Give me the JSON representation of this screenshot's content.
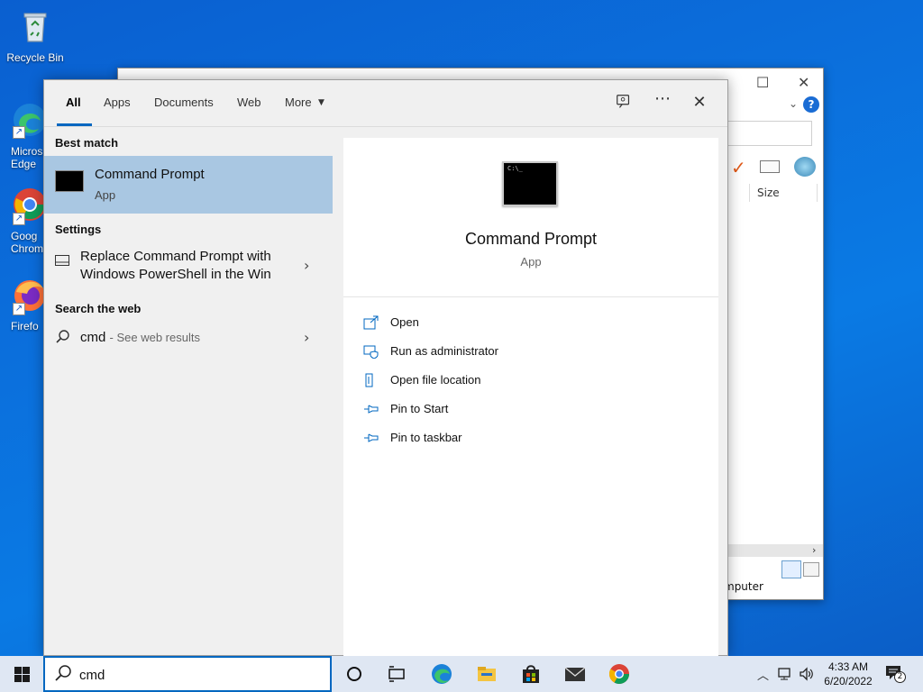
{
  "desktop": {
    "icons": [
      {
        "label": "Recycle Bin"
      },
      {
        "label": "Micros Edge"
      },
      {
        "label": "Goog Chrom"
      },
      {
        "label": "Firefo"
      }
    ]
  },
  "bg_window": {
    "size_header": "Size",
    "status": "mputer"
  },
  "search_panel": {
    "tabs": [
      {
        "label": "All"
      },
      {
        "label": "Apps"
      },
      {
        "label": "Documents"
      },
      {
        "label": "Web"
      },
      {
        "label": "More"
      }
    ],
    "best_match": {
      "header": "Best match",
      "title": "Command Prompt",
      "subtitle": "App"
    },
    "settings": {
      "header": "Settings",
      "line1": "Replace Command Prompt with",
      "line2": "Windows PowerShell in the Win"
    },
    "web": {
      "header": "Search the web",
      "query": "cmd",
      "suffix": "- See web results"
    },
    "detail": {
      "title": "Command Prompt",
      "subtitle": "App",
      "actions": [
        {
          "label": "Open",
          "icon": "open-icon"
        },
        {
          "label": "Run as administrator",
          "icon": "shield-icon"
        },
        {
          "label": "Open file location",
          "icon": "file-location-icon"
        },
        {
          "label": "Pin to Start",
          "icon": "pin-icon"
        },
        {
          "label": "Pin to taskbar",
          "icon": "pin-icon"
        }
      ]
    }
  },
  "taskbar": {
    "search_value": "cmd",
    "time": "4:33 AM",
    "date": "6/20/2022",
    "notification_count": "2"
  },
  "colors": {
    "accent": "#0067c0",
    "selection": "#a9c7e2",
    "taskbar": "#dfe7f3"
  }
}
